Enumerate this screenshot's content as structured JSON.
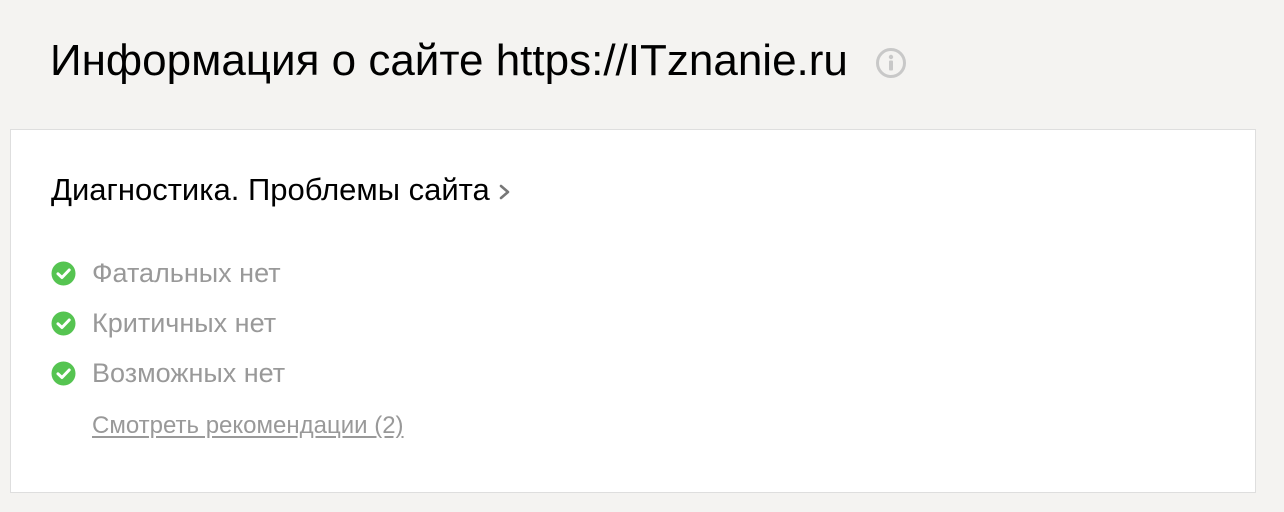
{
  "header": {
    "title": "Информация о сайте https://ITznanie.ru",
    "info_icon": "info-icon"
  },
  "diagnostics": {
    "title": "Диагностика. Проблемы сайта",
    "chevron_icon": "chevron-right-icon",
    "items": [
      {
        "label": "Фатальных нет",
        "icon": "check-circle-icon",
        "status": "ok"
      },
      {
        "label": "Критичных нет",
        "icon": "check-circle-icon",
        "status": "ok"
      },
      {
        "label": "Возможных нет",
        "icon": "check-circle-icon",
        "status": "ok"
      }
    ],
    "recommendations_link": "Смотреть рекомендации (2)"
  },
  "colors": {
    "background": "#f4f3f1",
    "card_background": "#ffffff",
    "card_border": "#dedede",
    "ok_green": "#55c451",
    "muted_text": "#999999",
    "icon_gray": "#c8c8c8"
  }
}
